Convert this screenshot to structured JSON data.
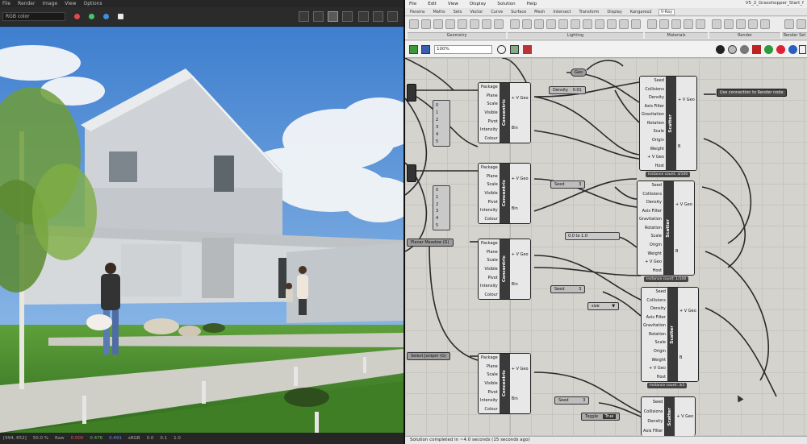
{
  "left_app": {
    "menu": [
      "File",
      "Render",
      "Image",
      "View",
      "Options"
    ],
    "view_select": "RGB color",
    "status": {
      "resolution": "[994, 652]",
      "zoom": "50.0 %",
      "mode": "Raw",
      "r_val": "0.000",
      "g_val": "0.476",
      "b_val": "0.491",
      "format": "sRGB",
      "field1": "0.0",
      "field2": "0.1",
      "field3": "1.0"
    },
    "colors": {
      "dot1": "#e04a4a",
      "dot2": "#45c46a",
      "dot3": "#3f8fe0",
      "dot4": "#eaeaea"
    }
  },
  "right_app": {
    "menu": [
      "File",
      "Edit",
      "View",
      "Display",
      "Solution",
      "Help"
    ],
    "title": "V5_2_Grasshopper_Start_f",
    "tabs": [
      "Params",
      "Maths",
      "Sets",
      "Vector",
      "Curve",
      "Surface",
      "Mesh",
      "Intersect",
      "Transform",
      "Display",
      "Kangaroo2",
      "V-Ray"
    ],
    "active_tab": "V-Ray",
    "ribbon_groups": [
      "Geometry",
      "Lighting",
      "Materials",
      "Render",
      "Render Set"
    ],
    "zoom": "100%",
    "status": "Solution completed in ~4.0 seconds (15 seconds ago)",
    "components": {
      "c1": {
        "ins": [
          "Package",
          "Plane",
          "Scale",
          "Visible",
          "Pivot",
          "Intensity",
          "Colour"
        ],
        "outs": [
          "+ V Geo",
          "Bin"
        ],
        "name": "Concentric"
      },
      "c2": {
        "ins": [
          "Package",
          "Plane",
          "Scale",
          "Visible",
          "Pivot",
          "Intensity",
          "Colour"
        ],
        "outs": [
          "+ V Geo",
          "Bin"
        ],
        "name": "Concentric"
      },
      "c3": {
        "ins": [
          "Package",
          "Plane",
          "Scale",
          "Visible",
          "Pivot",
          "Intensity",
          "Colour"
        ],
        "outs": [
          "+ V Geo",
          "Bin"
        ],
        "name": "Concentric"
      },
      "c4": {
        "ins": [
          "Package",
          "Plane",
          "Scale",
          "Visible",
          "Pivot",
          "Intensity",
          "Colour"
        ],
        "outs": [
          "+ V Geo",
          "Bin"
        ],
        "name": "Concentric"
      },
      "s1": {
        "ins": [
          "Seed",
          "Collisions",
          "Density",
          "Axis Filter",
          "Gravitation",
          "Rotation",
          "Scale",
          "Origin",
          "Weight",
          "+ V Geo",
          "Host"
        ],
        "outs": [
          "+ V Geo",
          "B"
        ],
        "name": "Scatter",
        "caption": "Instance count: 3/100"
      },
      "s2": {
        "ins": [
          "Seed",
          "Collisions",
          "Density",
          "Axis Filter",
          "Gravitation",
          "Rotation",
          "Scale",
          "Origin",
          "Weight",
          "+ V Geo",
          "Host"
        ],
        "outs": [
          "+ V Geo",
          "B"
        ],
        "name": "Scatter",
        "caption": "Instance count: 1/100"
      },
      "s3": {
        "ins": [
          "Seed",
          "Collisions",
          "Density",
          "Axis Filter",
          "Gravitation",
          "Rotation",
          "Scale",
          "Origin",
          "Weight",
          "+ V Geo",
          "Host"
        ],
        "outs": [
          "+ V Geo",
          "B"
        ],
        "name": "Scatter",
        "caption": "Instance count: 3/1"
      },
      "s4": {
        "ins": [
          "Seed",
          "Collisions",
          "Density",
          "Axis Filter"
        ],
        "outs": [
          "+ V Geo"
        ],
        "name": "Scatter"
      }
    },
    "params": {
      "geo": "Geo",
      "density": "Density",
      "density_val": "0.01",
      "out_label": "Use connection to Render node",
      "planar_meadow": "Planar Meadow (G)",
      "seed1": "Seed",
      "seed1_val": "3",
      "range": "0.0 to 1.0",
      "seed2": "Seed",
      "seed2_val": "3",
      "size": "size",
      "select_juniper": "Select Juniper (G)",
      "seed3": "Seed",
      "seed3_val": "3",
      "toggle": "Toggle",
      "true_val": "True",
      "list1": [
        "0",
        "1",
        "2",
        "3",
        "4",
        "5"
      ],
      "list2": [
        "0",
        "1",
        "2",
        "3",
        "4",
        "5"
      ]
    }
  }
}
